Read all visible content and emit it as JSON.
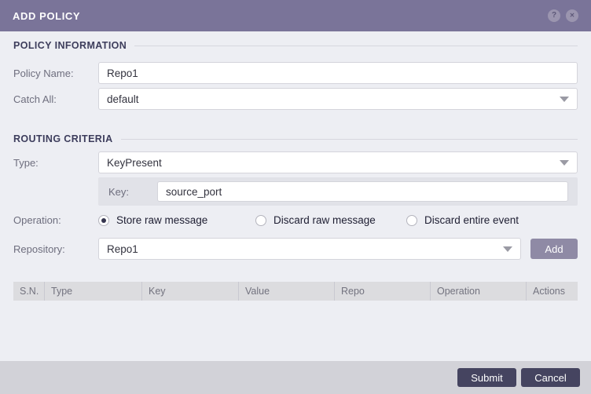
{
  "dialog": {
    "title": "ADD POLICY",
    "header_icons": {
      "help_glyph": "?",
      "close_glyph": "✕"
    }
  },
  "sections": {
    "policy_information": "POLICY INFORMATION",
    "routing_criteria": "ROUTING CRITERIA"
  },
  "fields": {
    "policy_name": {
      "label": "Policy Name:",
      "value": "Repo1"
    },
    "catch_all": {
      "label": "Catch All:",
      "value": "default"
    },
    "type": {
      "label": "Type:",
      "value": "KeyPresent"
    },
    "key": {
      "label": "Key:",
      "value": "source_port"
    },
    "operation": {
      "label": "Operation:",
      "options": [
        {
          "label": "Store raw message",
          "selected": true
        },
        {
          "label": "Discard raw message",
          "selected": false
        },
        {
          "label": "Discard entire event",
          "selected": false
        }
      ]
    },
    "repository": {
      "label": "Repository:",
      "value": "Repo1",
      "add_button_label": "Add"
    }
  },
  "table": {
    "columns": [
      "S.N.",
      "Type",
      "Key",
      "Value",
      "Repo",
      "Operation",
      "Actions"
    ],
    "rows": []
  },
  "footer": {
    "submit_label": "Submit",
    "cancel_label": "Cancel"
  },
  "colors": {
    "header_bg": "#7a7499",
    "body_bg": "#edeef3",
    "section_title": "#3d3d5c",
    "sub_panel_bg": "#e1e2e8",
    "add_button_bg": "#8f8aa5",
    "primary_button_bg": "#454460",
    "table_header_bg": "#dcdcdf",
    "footer_bg": "#d2d2d8"
  }
}
